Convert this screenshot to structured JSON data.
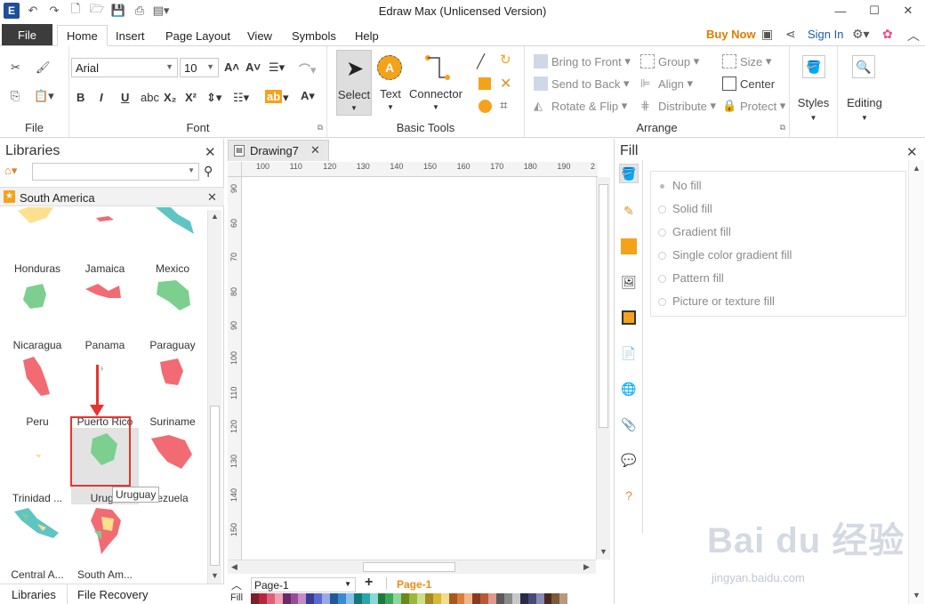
{
  "window": {
    "title": "Edraw Max (Unlicensed Version)",
    "app_logo": "E"
  },
  "menu": {
    "file": "File",
    "tabs": [
      "Home",
      "Insert",
      "Page Layout",
      "View",
      "Symbols",
      "Help"
    ],
    "buy_now": "Buy Now",
    "sign_in": "Sign In"
  },
  "ribbon": {
    "groups": {
      "file": "File",
      "font": "Font",
      "basic_tools": "Basic Tools",
      "arrange": "Arrange"
    },
    "font_family": "Arial",
    "font_size": "10",
    "tools": {
      "select": "Select",
      "text": "Text",
      "connector": "Connector"
    },
    "arrange": {
      "bring_to_front": "Bring to Front",
      "send_to_back": "Send to Back",
      "rotate_flip": "Rotate & Flip",
      "group": "Group",
      "align": "Align",
      "distribute": "Distribute",
      "size": "Size",
      "center": "Center",
      "protect": "Protect"
    },
    "styles": "Styles",
    "editing": "Editing"
  },
  "libraries": {
    "title": "Libraries",
    "category": "South America",
    "shapes": [
      {
        "name": "Honduras",
        "color": "#fde08e"
      },
      {
        "name": "Jamaica",
        "color": "#f26b72"
      },
      {
        "name": "Mexico",
        "color": "#5fc5c4"
      },
      {
        "name": "Nicaragua",
        "color": "#7ccf8f"
      },
      {
        "name": "Panama",
        "color": "#f26b72"
      },
      {
        "name": "Paraguay",
        "color": "#7ccf8f"
      },
      {
        "name": "Peru",
        "color": "#f26b72"
      },
      {
        "name": "Puerto Rico",
        "color": "#7ccf8f"
      },
      {
        "name": "Suriname",
        "color": "#f26b72"
      },
      {
        "name": "Trinidad ...",
        "color": "#fde08e"
      },
      {
        "name": "Urugu",
        "color": "#7ccf8f"
      },
      {
        "name": "ezuela",
        "color": "#f26b72"
      },
      {
        "name": "Central A...",
        "color": "#5fc5c4"
      },
      {
        "name": "South Am...",
        "color": "#f26b72"
      }
    ],
    "tooltip": "Uruguay",
    "bottom_tabs": [
      "Libraries",
      "File Recovery"
    ]
  },
  "document": {
    "tab": "Drawing7",
    "ruler_h": [
      "100",
      "110",
      "120",
      "130",
      "140",
      "150",
      "160",
      "170",
      "180",
      "190",
      "2"
    ],
    "ruler_v": [
      "90",
      "60",
      "70",
      "80",
      "90",
      "100",
      "110",
      "120",
      "130",
      "140",
      "150",
      "1"
    ],
    "page_select": "Page-1",
    "page_active": "Page-1",
    "fill_label": "Fill"
  },
  "fill_panel": {
    "title": "Fill",
    "options": [
      "No fill",
      "Solid fill",
      "Gradient fill",
      "Single color gradient fill",
      "Pattern fill",
      "Picture or texture fill"
    ],
    "selected": 0
  },
  "watermark": {
    "brand": "Bai du 经验",
    "url": "jingyan.baidu.com"
  }
}
